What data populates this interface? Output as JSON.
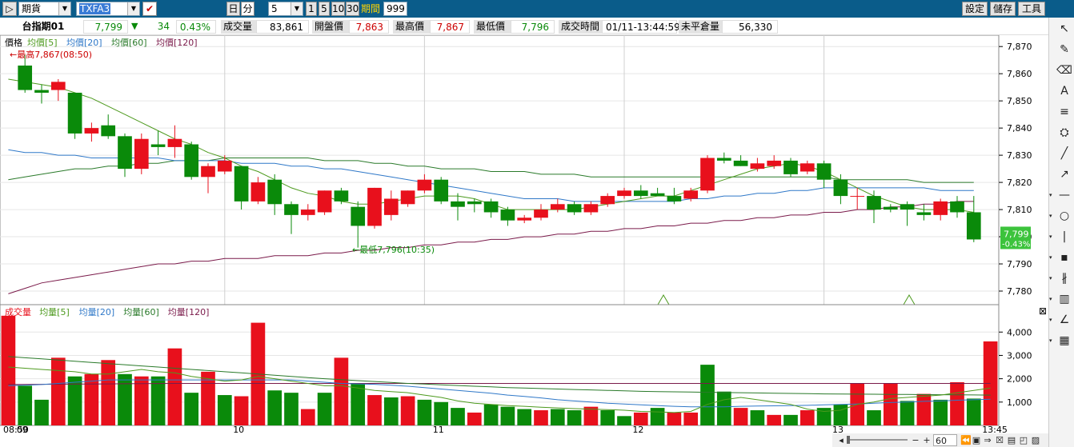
{
  "toolbar": {
    "play_label": "▷",
    "market": "期貨",
    "symbol": "TXFA3",
    "check": "✔",
    "unit_day": "日",
    "unit_min": "分",
    "interval": "5",
    "btn_1": "1",
    "btn_5": "5",
    "btn_10": "10",
    "btn_30": "30",
    "period_label": "期間",
    "period_value": "999",
    "settings": "設定",
    "save": "儲存",
    "tools": "工具"
  },
  "quote": {
    "name": "台指期01",
    "price": "7,799",
    "arrow": "▼",
    "change": "34",
    "pct": "0.43%",
    "volume_label": "成交量",
    "volume": "83,861",
    "open_label": "開盤價",
    "open": "7,863",
    "high_label": "最高價",
    "high": "7,867",
    "low_label": "最低價",
    "low": "7,796",
    "time_label": "成交時間",
    "time": "01/11-13:44:59",
    "oi_label": "未平倉量",
    "oi": "56,330"
  },
  "colors": {
    "up": "#e8101c",
    "down": "#0a8a0a",
    "ma5": "#4d9a1e",
    "ma20": "#2f78c8",
    "ma60": "#2a7a2a",
    "ma120": "#7a1a4a"
  },
  "chart_data": [
    {
      "type": "candlestick",
      "legend": [
        {
          "label": "價格",
          "color": "#000000"
        },
        {
          "label": "均價[5]",
          "color": "#4d9a1e"
        },
        {
          "label": "均價[20]",
          "color": "#2f78c8"
        },
        {
          "label": "均價[60]",
          "color": "#2a7a2a"
        },
        {
          "label": "均價[120]",
          "color": "#7a1a4a"
        }
      ],
      "ylim": [
        7775,
        7873
      ],
      "yticks": [
        "7,870",
        "7,860",
        "7,850",
        "7,840",
        "7,830",
        "7,820",
        "7,810",
        "7,800",
        "7,790",
        "7,780"
      ],
      "yticks_values": [
        7870,
        7860,
        7850,
        7840,
        7830,
        7820,
        7810,
        7800,
        7790,
        7780
      ],
      "xlabels": [
        "08:50",
        "09",
        "10",
        "11",
        "12",
        "13",
        "13:45"
      ],
      "xlabel_bar_index": [
        0,
        1,
        14,
        26,
        38,
        50,
        59
      ],
      "annotation_high": "←最高7,867(08:50)",
      "annotation_low": "←最低7,796(10:35)",
      "last_price_label": "7,799",
      "last_pct_label": "-0.43%",
      "ohlc": [
        [
          7863,
          7867,
          7853,
          7854
        ],
        [
          7854,
          7856,
          7849,
          7853
        ],
        [
          7854,
          7858,
          7850,
          7857
        ],
        [
          7853,
          7853,
          7836,
          7838
        ],
        [
          7838,
          7842,
          7835,
          7840
        ],
        [
          7841,
          7845,
          7836,
          7837
        ],
        [
          7837,
          7838,
          7822,
          7825
        ],
        [
          7825,
          7838,
          7823,
          7836
        ],
        [
          7834,
          7839,
          7830,
          7833
        ],
        [
          7833,
          7841,
          7829,
          7836
        ],
        [
          7834,
          7835,
          7821,
          7822
        ],
        [
          7822,
          7827,
          7816,
          7826
        ],
        [
          7824,
          7830,
          7823,
          7828
        ],
        [
          7826,
          7826,
          7810,
          7813
        ],
        [
          7813,
          7822,
          7812,
          7820
        ],
        [
          7821,
          7823,
          7808,
          7812
        ],
        [
          7812,
          7813,
          7801,
          7808
        ],
        [
          7808,
          7812,
          7806,
          7810
        ],
        [
          7809,
          7817,
          7808,
          7817
        ],
        [
          7817,
          7818,
          7812,
          7813
        ],
        [
          7811,
          7813,
          7796,
          7804
        ],
        [
          7804,
          7818,
          7803,
          7818
        ],
        [
          7808,
          7817,
          7806,
          7814
        ],
        [
          7812,
          7817,
          7811,
          7817
        ],
        [
          7817,
          7823,
          7816,
          7821
        ],
        [
          7821,
          7822,
          7812,
          7813
        ],
        [
          7813,
          7816,
          7806,
          7811
        ],
        [
          7813,
          7814,
          7809,
          7812
        ],
        [
          7813,
          7814,
          7807,
          7809
        ],
        [
          7810,
          7811,
          7804,
          7806
        ],
        [
          7806,
          7808,
          7805,
          7807
        ],
        [
          7807,
          7812,
          7806,
          7810
        ],
        [
          7810,
          7814,
          7809,
          7812
        ],
        [
          7812,
          7813,
          7808,
          7809
        ],
        [
          7809,
          7813,
          7808,
          7812
        ],
        [
          7812,
          7816,
          7811,
          7815
        ],
        [
          7815,
          7818,
          7814,
          7817
        ],
        [
          7817,
          7819,
          7814,
          7815
        ],
        [
          7816,
          7818,
          7815,
          7815
        ],
        [
          7815,
          7818,
          7812,
          7813
        ],
        [
          7814,
          7818,
          7813,
          7817
        ],
        [
          7817,
          7830,
          7816,
          7829
        ],
        [
          7829,
          7831,
          7827,
          7828
        ],
        [
          7828,
          7830,
          7826,
          7826
        ],
        [
          7825,
          7829,
          7824,
          7827
        ],
        [
          7826,
          7830,
          7825,
          7828
        ],
        [
          7828,
          7829,
          7822,
          7823
        ],
        [
          7824,
          7828,
          7823,
          7827
        ],
        [
          7827,
          7828,
          7818,
          7821
        ],
        [
          7821,
          7823,
          7812,
          7815
        ],
        [
          7815,
          7818,
          7810,
          7815
        ],
        [
          7815,
          7817,
          7805,
          7810
        ],
        [
          7811,
          7812,
          7809,
          7810
        ],
        [
          7812,
          7813,
          7804,
          7810
        ],
        [
          7809,
          7812,
          7806,
          7808
        ],
        [
          7808,
          7814,
          7806,
          7813
        ],
        [
          7813,
          7815,
          7807,
          7809
        ],
        [
          7809,
          7815,
          7798,
          7799
        ]
      ],
      "ma5": [
        7858,
        7857,
        7856,
        7855,
        7853,
        7851,
        7848,
        7845,
        7842,
        7839,
        7836,
        7834,
        7831,
        7829,
        7826,
        7824,
        7821,
        7818,
        7816,
        7815,
        7813,
        7812,
        7812,
        7813,
        7814,
        7815,
        7815,
        7815,
        7814,
        7812,
        7810,
        7810,
        7810,
        7810,
        7810,
        7811,
        7812,
        7813,
        7814,
        7815,
        7815,
        7817,
        7819,
        7821,
        7823,
        7825,
        7826,
        7827,
        7826,
        7824,
        7821,
        7818,
        7815,
        7813,
        7811,
        7810,
        7810,
        7810,
        7809
      ],
      "ma20": [
        7832,
        7831,
        7831,
        7830,
        7830,
        7829,
        7829,
        7829,
        7829,
        7829,
        7828,
        7828,
        7828,
        7828,
        7827,
        7827,
        7827,
        7826,
        7826,
        7825,
        7825,
        7824,
        7823,
        7822,
        7821,
        7820,
        7819,
        7818,
        7817,
        7816,
        7815,
        7814,
        7814,
        7814,
        7813,
        7813,
        7813,
        7813,
        7813,
        7813,
        7813,
        7814,
        7814,
        7815,
        7815,
        7816,
        7816,
        7817,
        7817,
        7818,
        7818,
        7818,
        7818,
        7818,
        7818,
        7818,
        7817,
        7817,
        7817
      ],
      "ma60": [
        7821,
        7822,
        7823,
        7824,
        7825,
        7825,
        7826,
        7826,
        7827,
        7827,
        7828,
        7828,
        7828,
        7829,
        7829,
        7829,
        7829,
        7829,
        7829,
        7828,
        7828,
        7828,
        7827,
        7827,
        7826,
        7826,
        7825,
        7825,
        7825,
        7824,
        7824,
        7824,
        7823,
        7823,
        7823,
        7822,
        7822,
        7822,
        7822,
        7822,
        7822,
        7822,
        7822,
        7822,
        7822,
        7822,
        7822,
        7822,
        7822,
        7822,
        7821,
        7821,
        7821,
        7821,
        7821,
        7820,
        7820,
        7820,
        7820
      ],
      "ma120": [
        7779,
        7781,
        7783,
        7784,
        7785,
        7786,
        7787,
        7788,
        7789,
        7790,
        7790,
        7791,
        7791,
        7792,
        7792,
        7792,
        7793,
        7793,
        7793,
        7794,
        7794,
        7795,
        7795,
        7796,
        7796,
        7797,
        7797,
        7798,
        7798,
        7799,
        7799,
        7800,
        7800,
        7801,
        7801,
        7802,
        7802,
        7803,
        7803,
        7804,
        7804,
        7805,
        7805,
        7806,
        7806,
        7807,
        7807,
        7808,
        7808,
        7809,
        7809,
        7810,
        7810,
        7811,
        7811,
        7812,
        7812,
        7813,
        7813
      ]
    },
    {
      "type": "bar",
      "legend": [
        {
          "label": "成交量",
          "color": "#e8101c"
        },
        {
          "label": "均量[5]",
          "color": "#4d9a1e"
        },
        {
          "label": "均量[20]",
          "color": "#2f78c8"
        },
        {
          "label": "均量[60]",
          "color": "#2a7a2a"
        },
        {
          "label": "均量[120]",
          "color": "#7a1a4a"
        }
      ],
      "ylim": [
        0,
        4900
      ],
      "yticks": [
        "4,000",
        "3,000",
        "2,000",
        "1,000"
      ],
      "yticks_values": [
        4000,
        3000,
        2000,
        1000
      ],
      "values": [
        4700,
        1700,
        1100,
        2900,
        2100,
        2200,
        2800,
        2200,
        2100,
        2100,
        3300,
        1400,
        2300,
        1300,
        1250,
        4400,
        1500,
        1400,
        700,
        1400,
        2900,
        1800,
        1300,
        1200,
        1250,
        1100,
        1000,
        750,
        550,
        900,
        800,
        700,
        650,
        700,
        650,
        800,
        650,
        400,
        550,
        750,
        550,
        550,
        2600,
        1450,
        750,
        650,
        450,
        450,
        650,
        750,
        900,
        1800,
        650,
        1800,
        1050,
        1350,
        1100,
        1850,
        1150,
        3600
      ],
      "up": [
        1,
        0,
        0,
        1,
        0,
        1,
        1,
        0,
        1,
        0,
        1,
        0,
        1,
        0,
        1,
        1,
        0,
        0,
        1,
        0,
        1,
        0,
        1,
        0,
        1,
        0,
        0,
        0,
        1,
        0,
        0,
        0,
        1,
        0,
        0,
        1,
        0,
        0,
        1,
        0,
        1,
        1,
        0,
        0,
        1,
        0,
        1,
        0,
        1,
        0,
        0,
        1,
        0,
        1,
        0,
        1,
        0,
        1,
        0,
        1
      ],
      "ma5": [
        2500,
        2450,
        2400,
        2350,
        2300,
        2200,
        2200,
        2300,
        2400,
        2300,
        2250,
        2100,
        2000,
        1900,
        1950,
        2100,
        2000,
        1900,
        1800,
        1700,
        1700,
        1600,
        1500,
        1450,
        1400,
        1300,
        1200,
        1050,
        950,
        900,
        850,
        820,
        780,
        750,
        720,
        700,
        680,
        650,
        600,
        580,
        550,
        600,
        900,
        1100,
        1200,
        1100,
        1000,
        900,
        700,
        600,
        650,
        900,
        1000,
        1150,
        1200,
        1250,
        1300,
        1400,
        1500,
        1600
      ],
      "ma20": [
        1700,
        1720,
        1750,
        1800,
        1850,
        1900,
        1950,
        1950,
        1950,
        1950,
        1950,
        1950,
        1950,
        1950,
        1950,
        1950,
        1950,
        1950,
        1900,
        1850,
        1800,
        1780,
        1760,
        1720,
        1680,
        1620,
        1560,
        1500,
        1440,
        1380,
        1300,
        1240,
        1180,
        1100,
        1050,
        1000,
        950,
        920,
        880,
        850,
        820,
        800,
        800,
        800,
        820,
        830,
        840,
        850,
        860,
        880,
        900,
        920,
        950,
        980,
        1000,
        1030,
        1050,
        1080,
        1100,
        1120
      ],
      "ma60": [
        2950,
        2900,
        2850,
        2800,
        2750,
        2700,
        2650,
        2600,
        2550,
        2500,
        2450,
        2400,
        2350,
        2300,
        2250,
        2200,
        2150,
        2100,
        2050,
        2000,
        1960,
        1920,
        1880,
        1840,
        1800,
        1770,
        1740,
        1710,
        1680,
        1650,
        1620,
        1600,
        1580,
        1560,
        1540,
        1520,
        1500,
        1480,
        1460,
        1450,
        1440,
        1430,
        1420,
        1410,
        1400,
        1390,
        1380,
        1370,
        1360,
        1350,
        1345,
        1340,
        1335,
        1330,
        1325,
        1320,
        1315,
        1310,
        1305,
        1300
      ],
      "ma120": [
        1750,
        1755,
        1760,
        1765,
        1770,
        1775,
        1780,
        1785,
        1790,
        1795,
        1800,
        1800,
        1800,
        1800,
        1800,
        1800,
        1800,
        1800,
        1800,
        1800,
        1800,
        1800,
        1800,
        1800,
        1800,
        1800,
        1800,
        1800,
        1800,
        1800,
        1800,
        1800,
        1800,
        1800,
        1800,
        1800,
        1800,
        1800,
        1800,
        1800,
        1800,
        1800,
        1800,
        1800,
        1800,
        1800,
        1800,
        1800,
        1800,
        1800,
        1800,
        1800,
        1800,
        1800,
        1800,
        1800,
        1800,
        1800,
        1800,
        1800
      ]
    }
  ],
  "bottom": {
    "zoom_value": "60",
    "minus": "−",
    "plus": "+"
  },
  "sidebar_icons": [
    "cursor-icon",
    "pencil-icon",
    "eraser-icon",
    "text-icon",
    "hline-icon",
    "fib-icon",
    "line-icon",
    "arrow-icon",
    "horizontal-icon",
    "circle-icon",
    "vertical-icon",
    "marker-icon",
    "fan-icon",
    "channel-icon",
    "angle-icon",
    "grid-icon"
  ]
}
